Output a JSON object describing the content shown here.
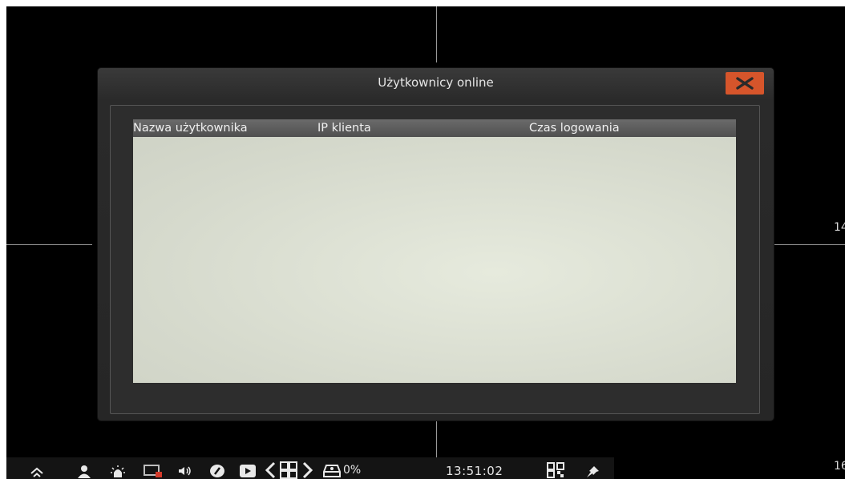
{
  "dialog": {
    "title": "Użytkownicy online",
    "columns": [
      "Nazwa użytkownika",
      "IP klienta",
      "Czas logowania"
    ],
    "rows": []
  },
  "channels": {
    "label_right_mid": "14",
    "label_right_bottom": "16"
  },
  "taskbar": {
    "hdd_usage": "0%",
    "clock": "13:51:02",
    "icons": [
      "home-icon",
      "user-icon",
      "alarm-icon",
      "display-icon",
      "volume-icon",
      "edit-icon",
      "playback-icon",
      "previous-icon",
      "grid-layout-icon",
      "next-icon",
      "hdd-icon",
      "qr-icon",
      "pin-icon"
    ]
  },
  "colors": {
    "close_button": "#d6552b",
    "background": "#000000"
  }
}
